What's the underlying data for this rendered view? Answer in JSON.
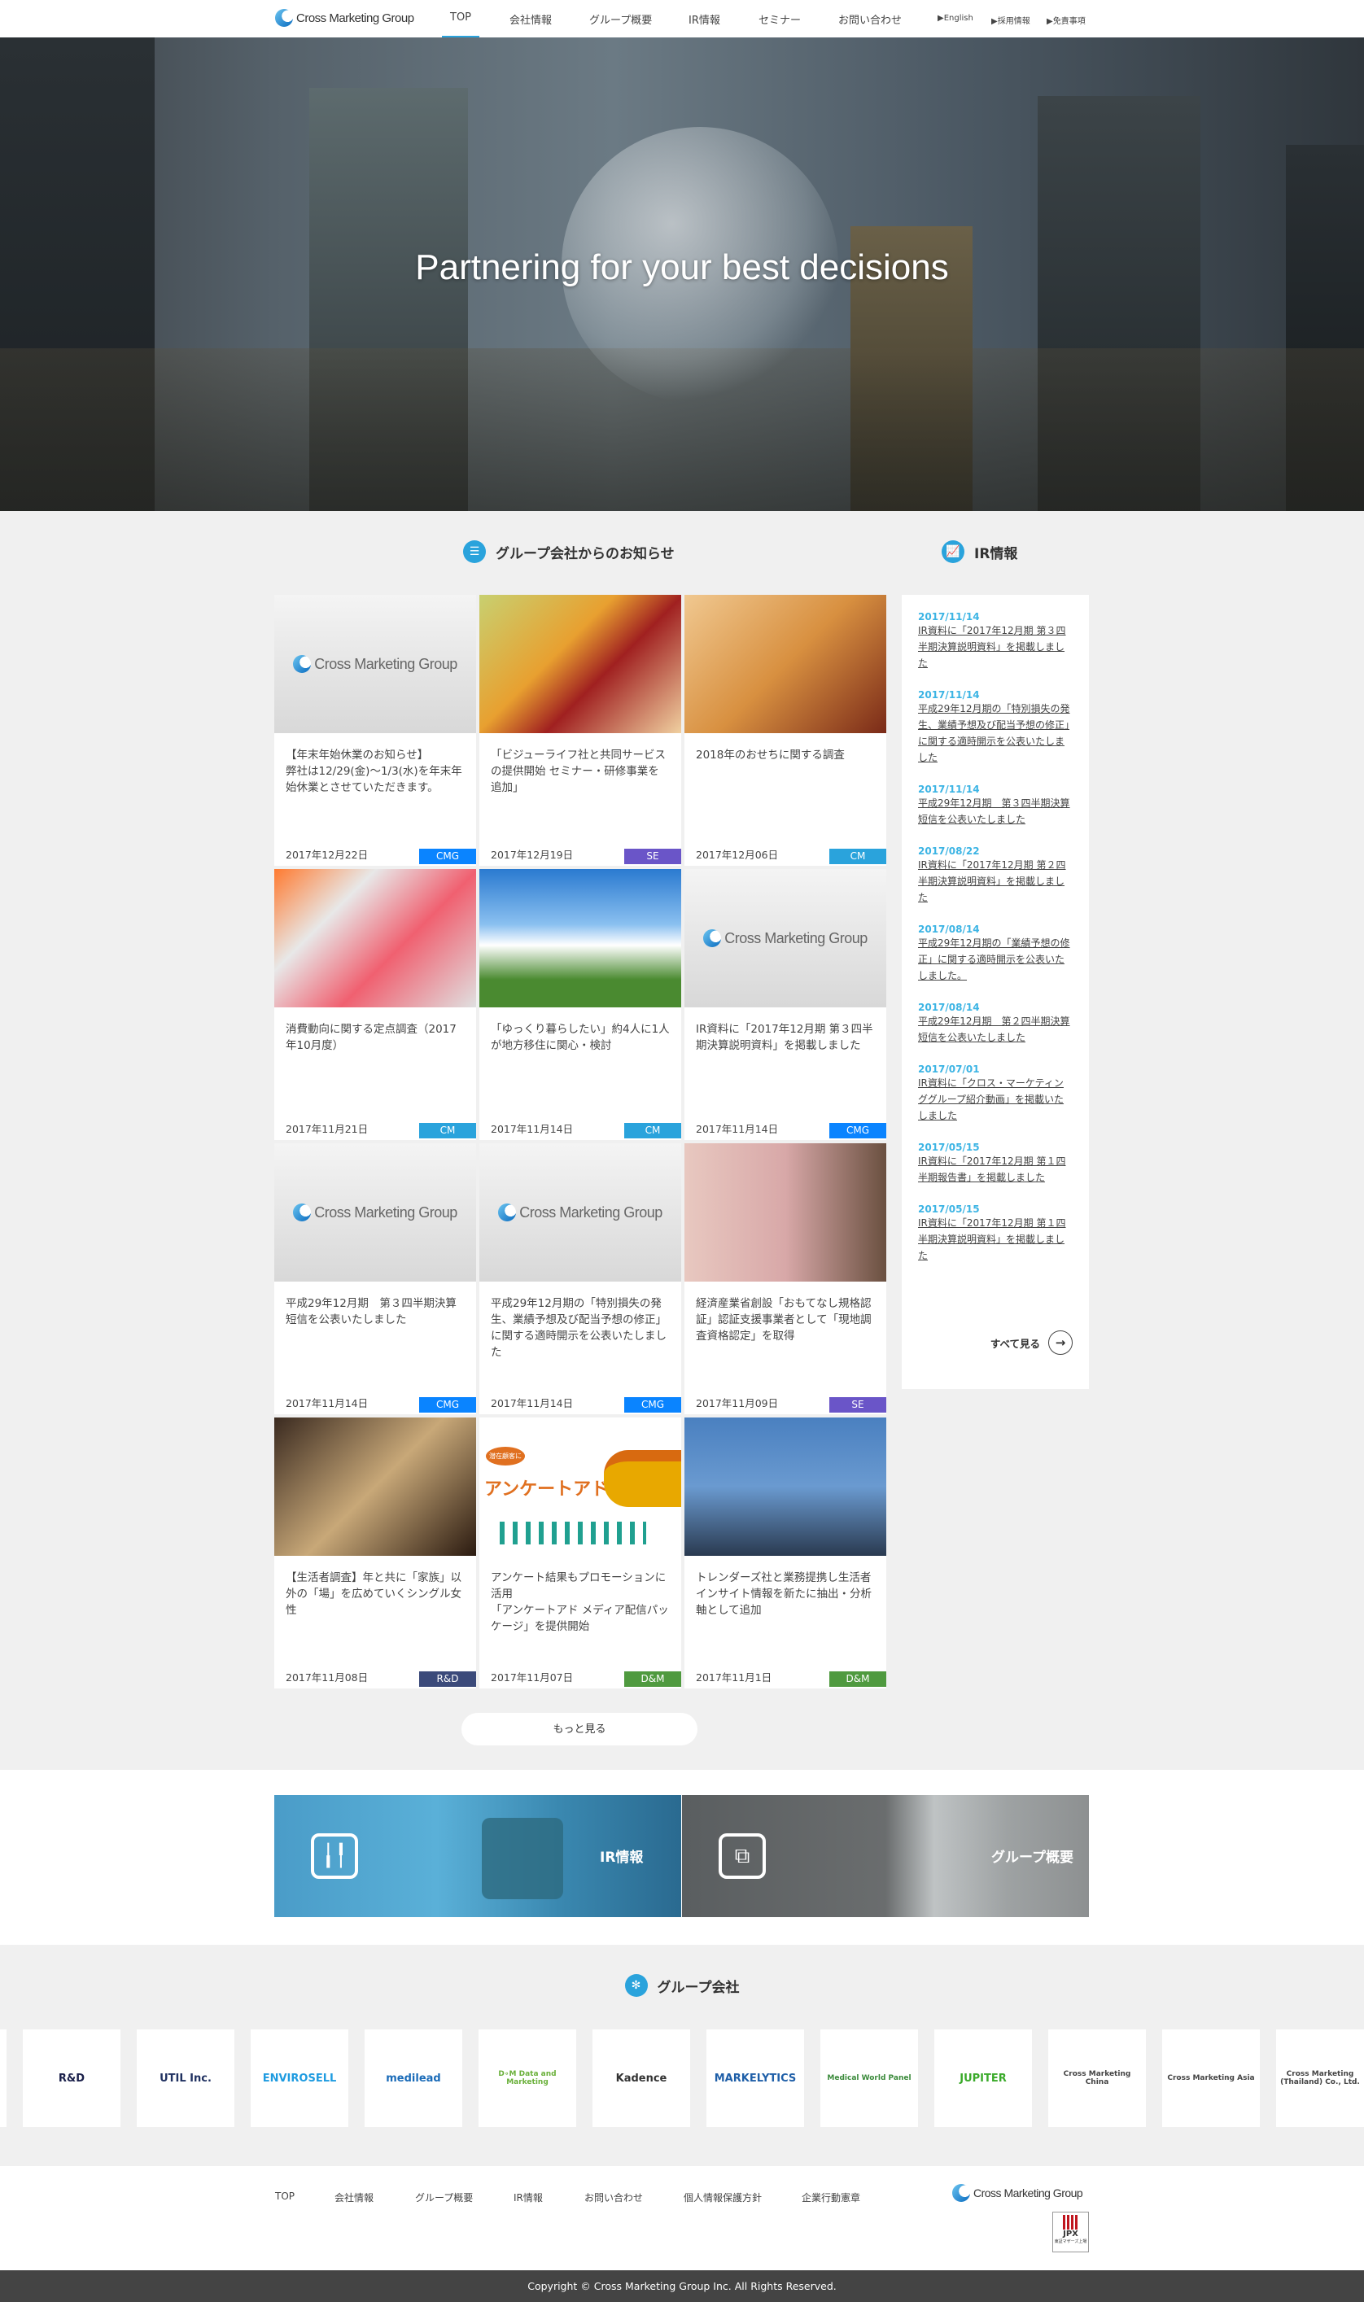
{
  "header": {
    "logo_text": "Cross Marketing Group",
    "nav": [
      "TOP",
      "会社情報",
      "グループ概要",
      "IR情報",
      "セミナー",
      "お問い合わせ"
    ],
    "sub_links": [
      "▶English",
      "▶採用情報",
      "▶免責事項"
    ]
  },
  "hero": {
    "title": "Partnering for your best decisions"
  },
  "news": {
    "heading": "グループ会社からのお知らせ",
    "icon": "list-icon",
    "more_label": "もっと見る",
    "items": [
      {
        "text": "【年末年始休業のお知らせ】\n弊社は12/29(金)〜1/3(水)を年末年始休業とさせていただきます。",
        "date": "2017年12月22日",
        "badge": "CMG",
        "image": "logo",
        "logo_text": "Cross Marketing Group"
      },
      {
        "text": "「ビジューライフ社と共同サービスの提供開始 セミナー・研修事業を追加」",
        "date": "2017年12月19日",
        "badge": "SE",
        "image": "photo-grocer"
      },
      {
        "text": "2018年のおせちに関する調査",
        "date": "2017年12月06日",
        "badge": "CM",
        "image": "photo-osechi"
      },
      {
        "text": "消費動向に関する定点調査（2017年10月度）",
        "date": "2017年11月21日",
        "badge": "CM",
        "image": "photo-sports"
      },
      {
        "text": "「ゆっくり暮らしたい」約4人に1人が地方移住に関心・検討",
        "date": "2017年11月14日",
        "badge": "CM",
        "image": "photo-sky"
      },
      {
        "text": "IR資料に「2017年12月期 第３四半期決算説明資料」を掲載しました",
        "date": "2017年11月14日",
        "badge": "CMG",
        "image": "logo",
        "logo_text": "Cross Marketing Group"
      },
      {
        "text": "平成29年12月期　第３四半期決算短信を公表いたしました",
        "date": "2017年11月14日",
        "badge": "CMG",
        "image": "logo",
        "logo_text": "Cross Marketing Group"
      },
      {
        "text": "平成29年12月期の「特別損失の発生、業績予想及び配当予想の修正」に関する適時開示を公表いたしました",
        "date": "2017年11月14日",
        "badge": "CMG",
        "image": "logo",
        "logo_text": "Cross Marketing Group"
      },
      {
        "text": "経済産業省創設「おもてなし規格認証」認証支援事業者として「現地調査資格認定」を取得",
        "date": "2017年11月09日",
        "badge": "SE",
        "image": "photo-kimono"
      },
      {
        "text": "【生活者調査】年と共に「家族」以外の「場」を広めていくシングル女性",
        "date": "2017年11月08日",
        "badge": "R&D",
        "image": "photo-toast"
      },
      {
        "text": "アンケート結果もプロモーションに活用\n「アンケートアド メディア配信パッケージ」を提供開始",
        "date": "2017年11月07日",
        "badge": "D&M",
        "image": "anketo-ad",
        "image_text": "アンケートアド",
        "bubble_text": "潜在顧客に"
      },
      {
        "text": "トレンダーズ社と業務提携し生活者インサイト情報を新たに抽出・分析軸として追加",
        "date": "2017年11月1日",
        "badge": "D&M",
        "image": "photo-network"
      }
    ]
  },
  "badge_colors": {
    "CMG": "#0a84ff",
    "SE": "#6a55c8",
    "CM": "#2aa3dc",
    "R&D": "#3b4a7a",
    "D&M": "#4f9a3f"
  },
  "ir": {
    "heading": "IR情報",
    "icon": "chart-line-icon",
    "more_label": "すべて見る",
    "items": [
      {
        "date": "2017/11/14",
        "title": "IR資料に「2017年12月期 第３四半期決算説明資料」を掲載しました"
      },
      {
        "date": "2017/11/14",
        "title": "平成29年12月期の「特別損失の発生、業績予想及び配当予想の修正」に関する適時開示を公表いたしました"
      },
      {
        "date": "2017/11/14",
        "title": "平成29年12月期　第３四半期決算短信を公表いたしました"
      },
      {
        "date": "2017/08/22",
        "title": "IR資料に「2017年12月期 第２四半期決算説明資料」を掲載しました"
      },
      {
        "date": "2017/08/14",
        "title": "平成29年12月期の「業績予想の修正」に関する適時開示を公表いたしました。"
      },
      {
        "date": "2017/08/14",
        "title": "平成29年12月期　第２四半期決算短信を公表いたしました"
      },
      {
        "date": "2017/07/01",
        "title": "IR資料に「クロス・マーケティンググループ紹介動画」を掲載いたしました"
      },
      {
        "date": "2017/05/15",
        "title": "IR資料に「2017年12月期 第１四半期報告書」を掲載しました"
      },
      {
        "date": "2017/05/15",
        "title": "IR資料に「2017年12月期 第１四半期決算説明資料」を掲載しました"
      }
    ]
  },
  "banners": [
    {
      "label": "IR情報",
      "icon": "candlestick-icon"
    },
    {
      "label": "グループ概要",
      "icon": "org-chart-icon"
    }
  ],
  "group": {
    "heading": "グループ会社",
    "icon": "network-icon",
    "logos": [
      {
        "text": "",
        "color": "#333"
      },
      {
        "text": "R&D",
        "color": "#1a1f4a"
      },
      {
        "text": "UTIL Inc.",
        "color": "#1f3060"
      },
      {
        "text": "ENVIROSELL",
        "color": "#1e9be0"
      },
      {
        "text": "medilead",
        "color": "#1a6bb8"
      },
      {
        "text": "D∘M Data and Marketing",
        "color": "#6ab03a"
      },
      {
        "text": "Kadence",
        "color": "#333"
      },
      {
        "text": "MARKELYTICS",
        "color": "#1f5fa8"
      },
      {
        "text": "Medical World Panel",
        "color": "#3a8a3a"
      },
      {
        "text": "JUPITER",
        "color": "#3aaa2a"
      },
      {
        "text": "Cross Marketing China",
        "color": "#444"
      },
      {
        "text": "Cross Marketing Asia",
        "color": "#444"
      },
      {
        "text": "Cross Marketing (Thailand) Co., Ltd.",
        "color": "#444"
      }
    ]
  },
  "footer": {
    "nav": [
      "TOP",
      "会社情報",
      "グループ概要",
      "IR情報",
      "お問い合わせ",
      "個人情報保護方針",
      "企業行動憲章"
    ],
    "logo_text": "Cross Marketing Group",
    "jpx_text": "JPX",
    "jpx_sub": "東証マザーズ上場",
    "copyright": "Copyright © Cross Marketing Group Inc. All Rights Reserved."
  }
}
